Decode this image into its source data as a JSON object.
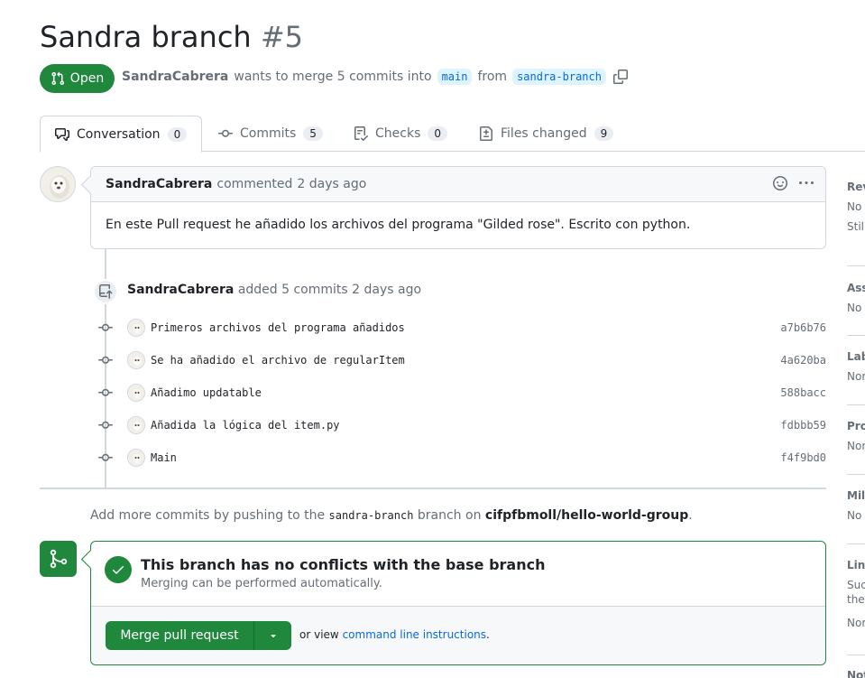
{
  "pr": {
    "title": "Sandra branch",
    "number": "#5",
    "state": "Open",
    "author": "SandraCabrera",
    "merge_text": "wants to merge 5 commits into",
    "base_branch": "main",
    "from_text": "from",
    "head_branch": "sandra-branch"
  },
  "tabs": [
    {
      "label": "Conversation",
      "count": "0",
      "icon": "comment-discussion-icon"
    },
    {
      "label": "Commits",
      "count": "5",
      "icon": "git-commit-icon"
    },
    {
      "label": "Checks",
      "count": "0",
      "icon": "checklist-icon"
    },
    {
      "label": "Files changed",
      "count": "9",
      "icon": "file-diff-icon"
    }
  ],
  "comment": {
    "author": "SandraCabrera",
    "action": "commented",
    "time": "2 days ago",
    "body": "En este Pull request he añadido los archivos del programa \"Gilded rose\". Escrito con python."
  },
  "push_event": {
    "author": "SandraCabrera",
    "text": "added 5 commits",
    "time": "2 days ago"
  },
  "commits": [
    {
      "message": "Primeros archivos del programa añadidos",
      "sha": "a7b6b76"
    },
    {
      "message": "Se ha añadido el archivo de regularItem",
      "sha": "4a620ba"
    },
    {
      "message": "Añadimo updatable",
      "sha": "588bacc"
    },
    {
      "message": "Añadida la lógica del item.py",
      "sha": "fdbbb59"
    },
    {
      "message": "Main",
      "sha": "f4f9bd0"
    }
  ],
  "push_hint": {
    "prefix": "Add more commits by pushing to the",
    "branch": "sandra-branch",
    "middle": "branch on",
    "repo": "cifpfbmoll/hello-world-group",
    "suffix": "."
  },
  "merge": {
    "title": "This branch has no conflicts with the base branch",
    "subtitle": "Merging can be performed automatically.",
    "button": "Merge pull request",
    "alt_prefix": "or view",
    "alt_link": "command line instructions",
    "alt_suffix": "."
  },
  "sidebar": [
    {
      "label": "Rev",
      "values": [
        "No",
        "Stil"
      ]
    },
    {
      "label": "Ass",
      "values": [
        "No"
      ]
    },
    {
      "label": "Lab",
      "values": [
        "Nor"
      ]
    },
    {
      "label": "Pro",
      "values": [
        "Nor"
      ]
    },
    {
      "label": "Mil",
      "values": [
        "No"
      ]
    },
    {
      "label": "Lin",
      "values": [
        "Suc",
        "the",
        "Nor"
      ]
    },
    {
      "label": "Not",
      "values": []
    }
  ],
  "colors": {
    "accent": "#1f883d",
    "link": "#0969da",
    "muted": "#656d76"
  }
}
